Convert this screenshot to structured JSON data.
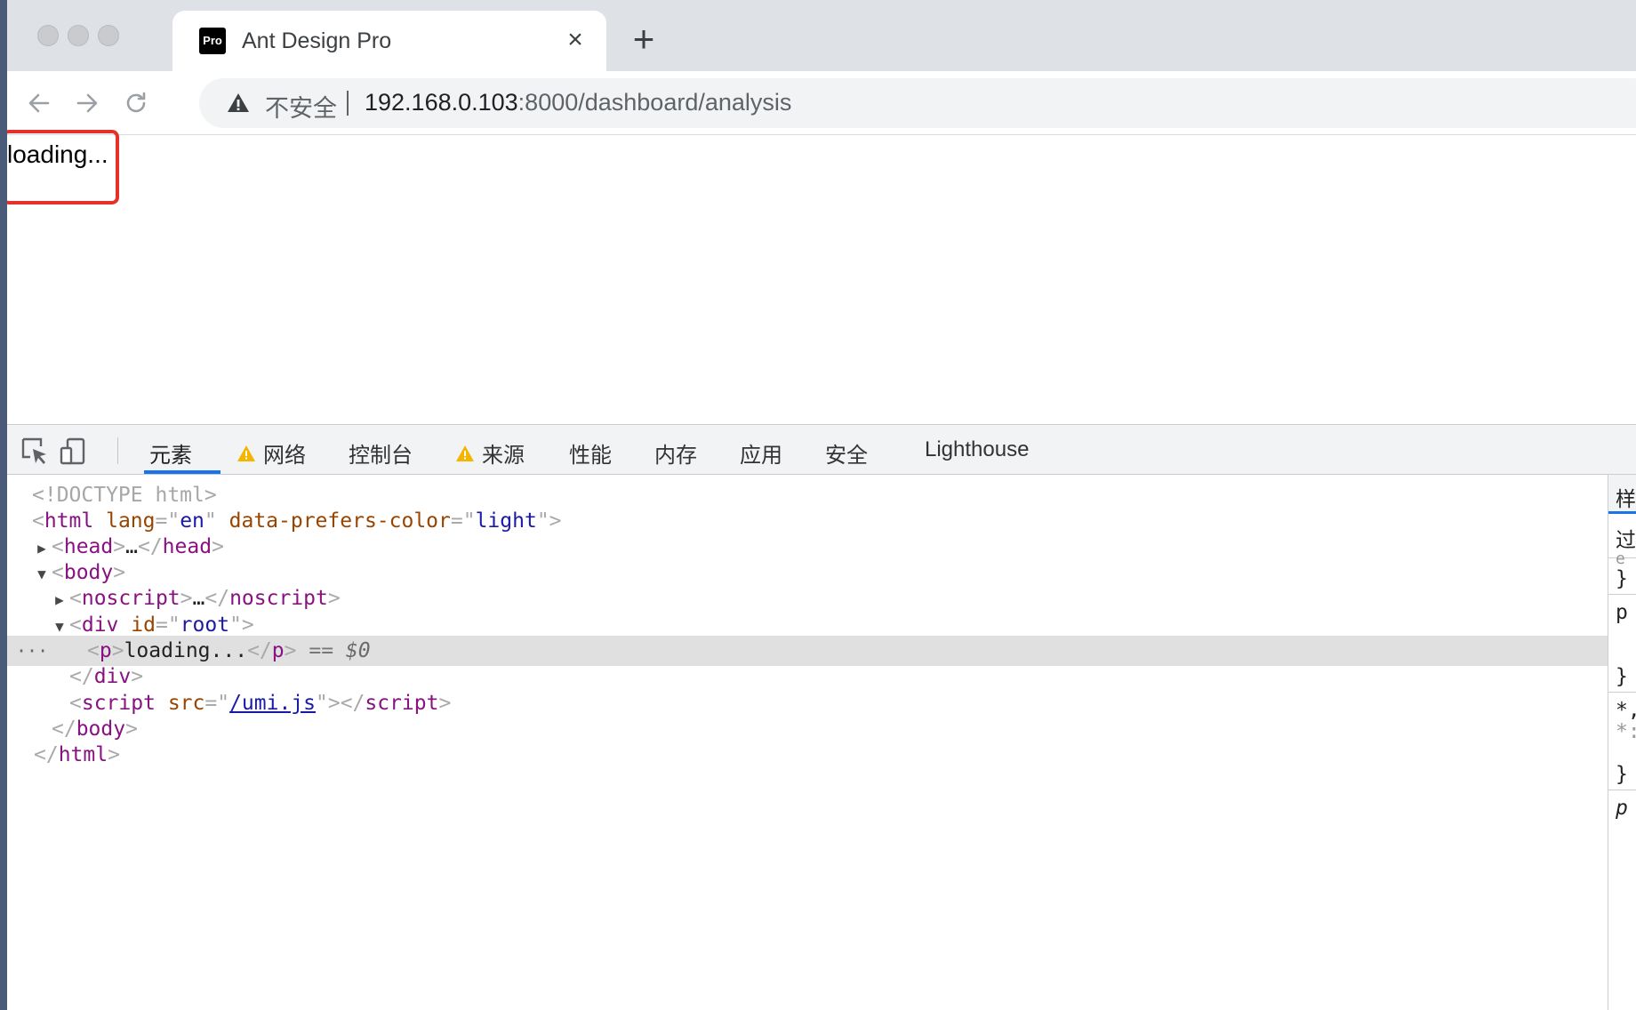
{
  "browser": {
    "tab_title": "Ant Design Pro",
    "tab_favicon_text": "Pro",
    "close_glyph": "×",
    "new_tab_glyph": "+",
    "security_label": "不安全",
    "url_host": "192.168.0.103",
    "url_rest": ":8000/dashboard/analysis"
  },
  "page": {
    "loading_text": "loading...",
    "highlight_color": "#e8302a"
  },
  "devtools": {
    "tabs": [
      {
        "label": "元素",
        "warning": false,
        "active": true
      },
      {
        "label": "网络",
        "warning": true,
        "active": false
      },
      {
        "label": "控制台",
        "warning": false,
        "active": false
      },
      {
        "label": "来源",
        "warning": true,
        "active": false
      },
      {
        "label": "性能",
        "warning": false,
        "active": false
      },
      {
        "label": "内存",
        "warning": false,
        "active": false
      },
      {
        "label": "应用",
        "warning": false,
        "active": false
      },
      {
        "label": "安全",
        "warning": false,
        "active": false
      },
      {
        "label": "Lighthouse",
        "warning": false,
        "active": false
      }
    ],
    "dom": {
      "doctype": "<!DOCTYPE html>",
      "html_lang": "en",
      "html_color_attr": "data-prefers-color",
      "html_color_val": "light",
      "head_collapsed": "…",
      "noscript_collapsed": "…",
      "div_id": "root",
      "p_text": "loading...",
      "selected_ref": "$0",
      "script_src": "/umi.js",
      "row_menu": "···"
    },
    "styles_fragments": [
      "样",
      "过",
      "e",
      "}",
      "p",
      "}",
      "*,",
      "*:",
      "}",
      "p"
    ]
  }
}
